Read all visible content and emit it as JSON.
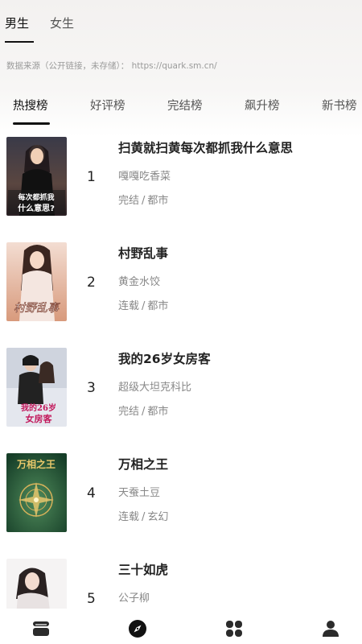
{
  "gender_tabs": [
    {
      "label": "男生",
      "active": true
    },
    {
      "label": "女生",
      "active": false
    }
  ],
  "source_text": "数据来源（公开链接，未存储）： https://quark.sm.cn/",
  "rank_tabs": [
    {
      "label": "热搜榜",
      "active": true
    },
    {
      "label": "好评榜",
      "active": false
    },
    {
      "label": "完结榜",
      "active": false
    },
    {
      "label": "飙升榜",
      "active": false
    },
    {
      "label": "新书榜",
      "active": false
    }
  ],
  "books": [
    {
      "rank": "1",
      "title": "扫黄就扫黄每次都抓我什么意思",
      "author": "嘎嘎吃香菜",
      "status": "完结",
      "sep": "/",
      "genre": "都市",
      "cover_text": "每次都抓我什么意思?",
      "cover_colors": [
        "#2b2b35",
        "#7a5a4a"
      ]
    },
    {
      "rank": "2",
      "title": "村野乱事",
      "author": "黄金水饺",
      "status": "连载",
      "sep": "/",
      "genre": "都市",
      "cover_text": "村野乱事",
      "cover_colors": [
        "#e8c8b8",
        "#c88a6a"
      ]
    },
    {
      "rank": "3",
      "title": "我的26岁女房客",
      "author": "超级大坦克科比",
      "status": "完结",
      "sep": "/",
      "genre": "都市",
      "cover_text": "我的26岁女房客",
      "cover_colors": [
        "#dfe3ea",
        "#3a3a4a"
      ]
    },
    {
      "rank": "4",
      "title": "万相之王",
      "author": "天蚕土豆",
      "status": "连载",
      "sep": "/",
      "genre": "玄幻",
      "cover_text": "万相之王",
      "cover_colors": [
        "#1f5a3a",
        "#3e7a4e"
      ]
    },
    {
      "rank": "5",
      "title": "三十如虎",
      "author": "公子柳",
      "status": "",
      "sep": "",
      "genre": "",
      "cover_text": "",
      "cover_colors": [
        "#f4f2f2",
        "#cfc6c6"
      ]
    }
  ],
  "nav": [
    {
      "icon": "bookshelf-icon"
    },
    {
      "icon": "compass-icon",
      "active": true
    },
    {
      "icon": "categories-icon"
    },
    {
      "icon": "profile-icon"
    }
  ]
}
